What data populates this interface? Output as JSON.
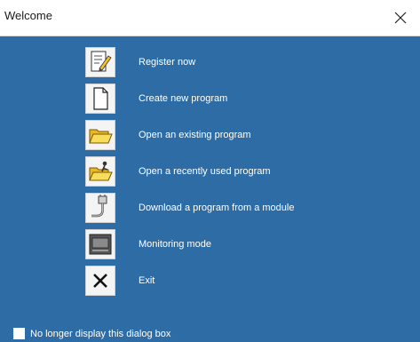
{
  "window": {
    "title": "Welcome",
    "close_glyph": "×",
    "title_bar_color": "#ffffff",
    "content_bg_color": "#2e6ca6",
    "label_color": "#ffffff"
  },
  "menu": {
    "items": [
      {
        "label": "Register now",
        "icon": "register-pencil-icon"
      },
      {
        "label": "Create new program",
        "icon": "new-document-icon"
      },
      {
        "label": "Open an existing program",
        "icon": "open-folder-icon"
      },
      {
        "label": "Open a recently used program",
        "icon": "recent-folder-icon"
      },
      {
        "label": "Download a program from a module",
        "icon": "download-module-icon"
      },
      {
        "label": "Monitoring mode",
        "icon": "monitor-icon"
      },
      {
        "label": "Exit",
        "icon": "exit-x-icon"
      }
    ]
  },
  "footer": {
    "checkbox_label": "No longer display this dialog box",
    "checked": false
  }
}
